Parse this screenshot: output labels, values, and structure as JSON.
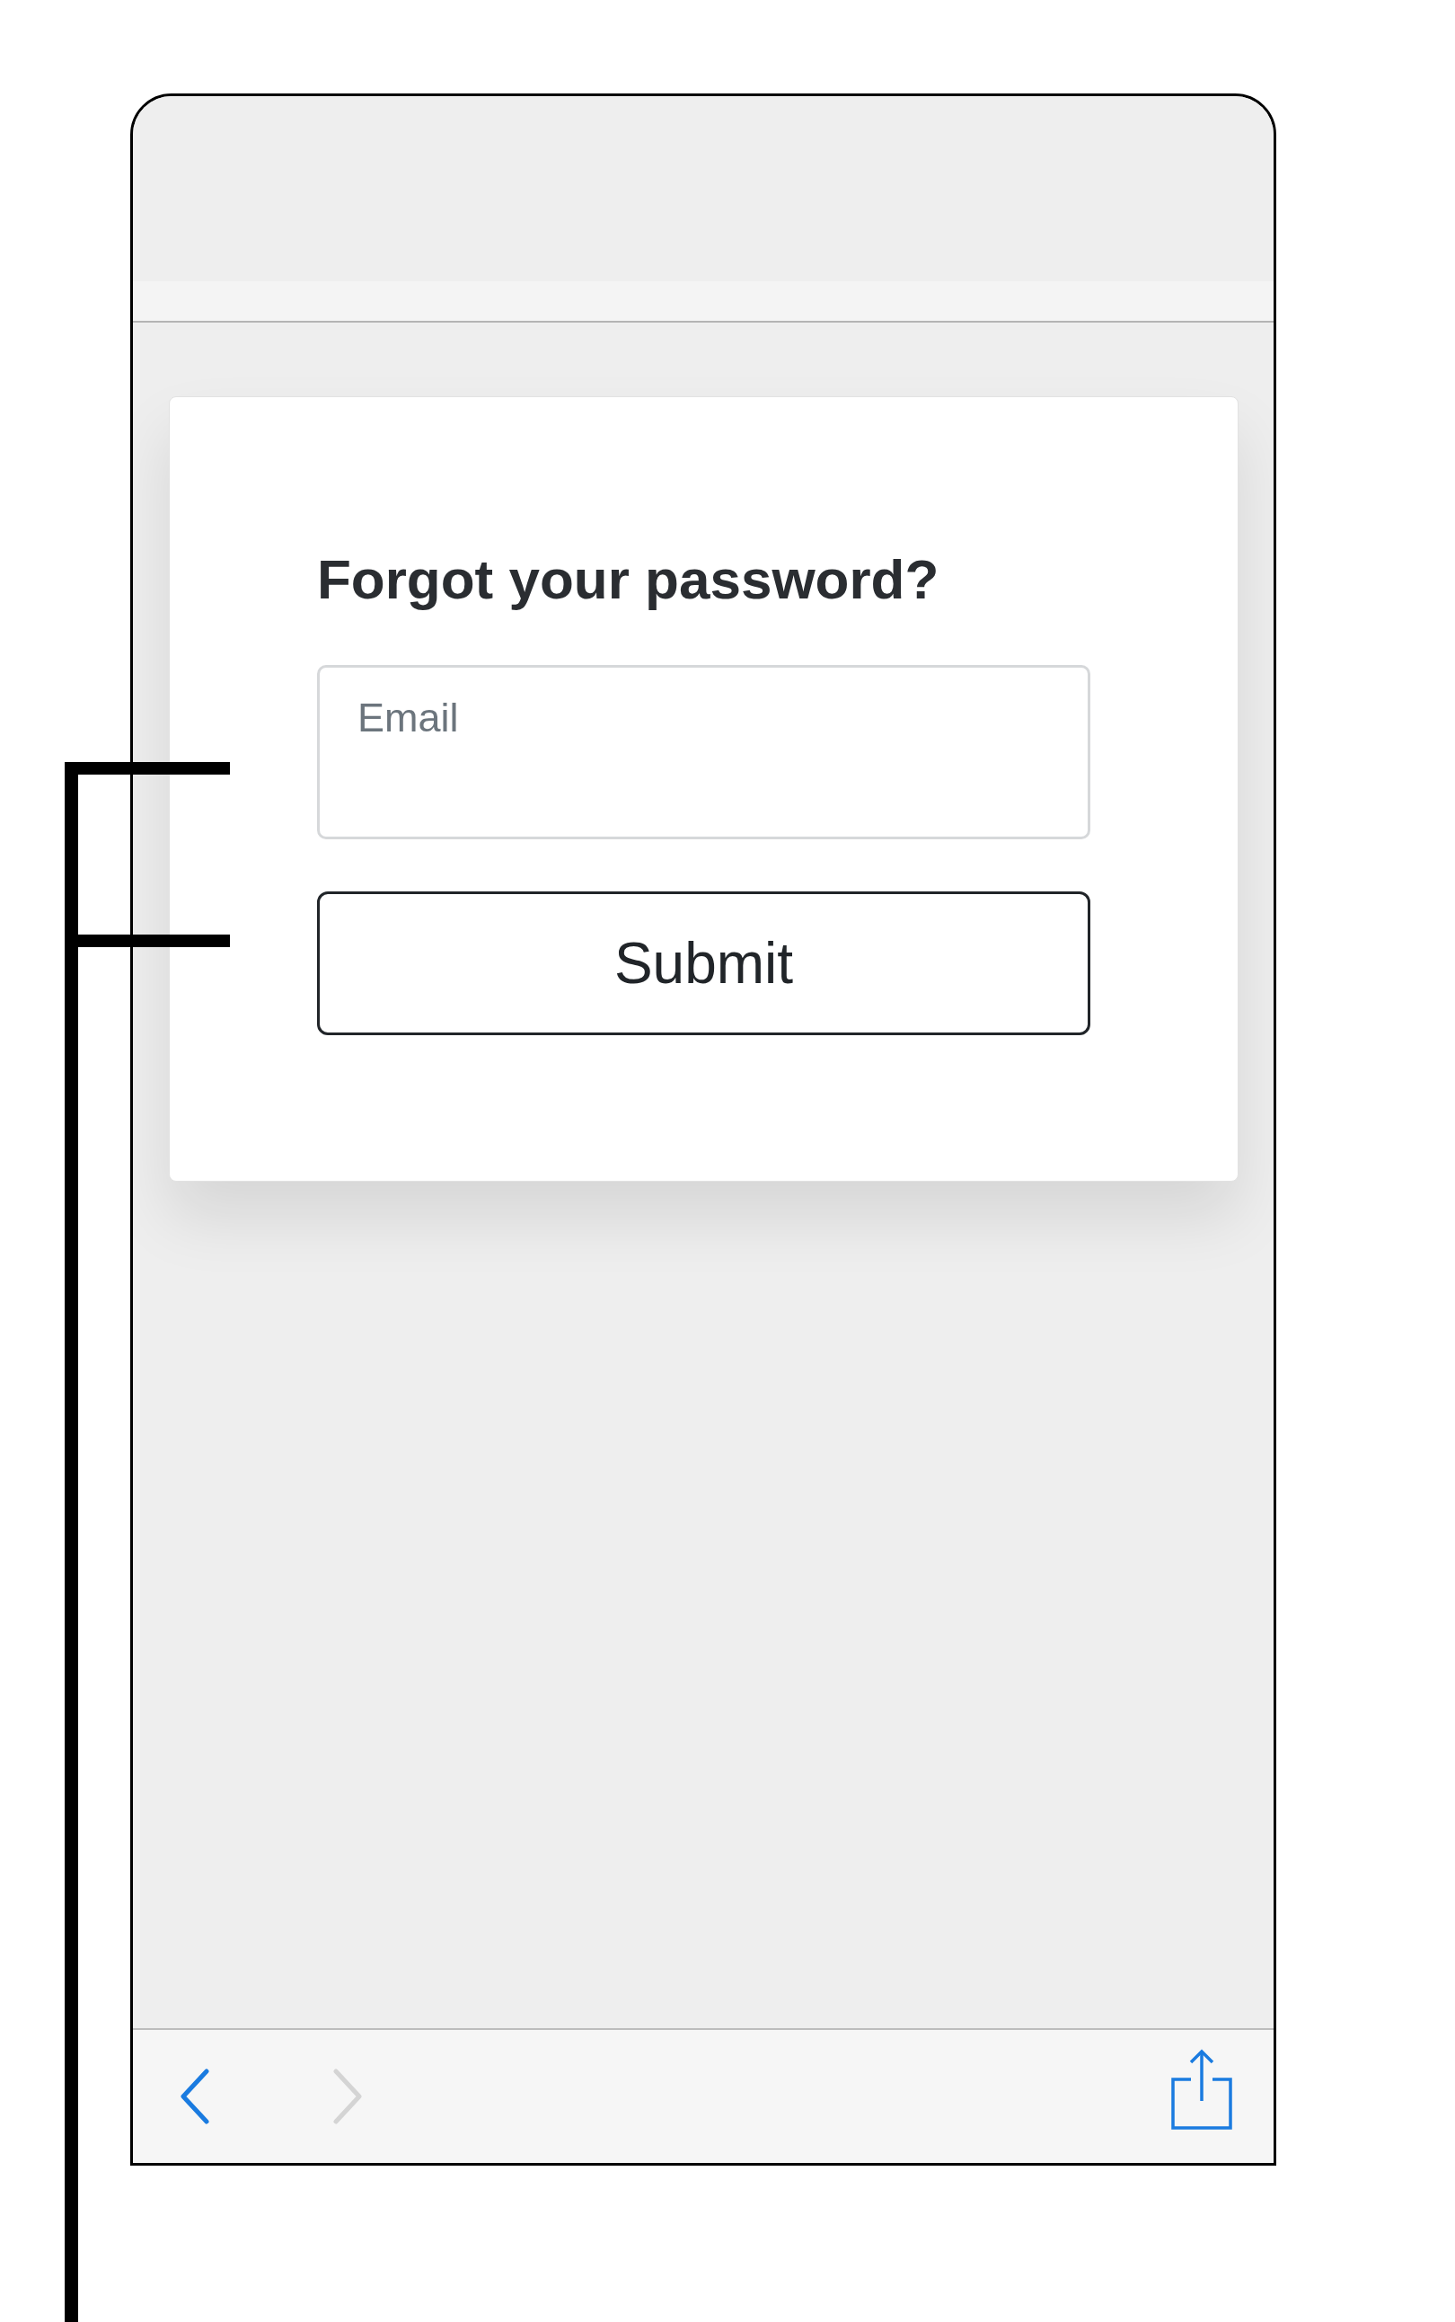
{
  "screen": {
    "card": {
      "title": "Forgot your password?",
      "email_field": {
        "placeholder": "Email"
      },
      "submit_button": {
        "label": "Submit"
      }
    },
    "toolbar": {
      "back": {
        "disabled": false
      },
      "forward": {
        "disabled": true
      }
    }
  }
}
